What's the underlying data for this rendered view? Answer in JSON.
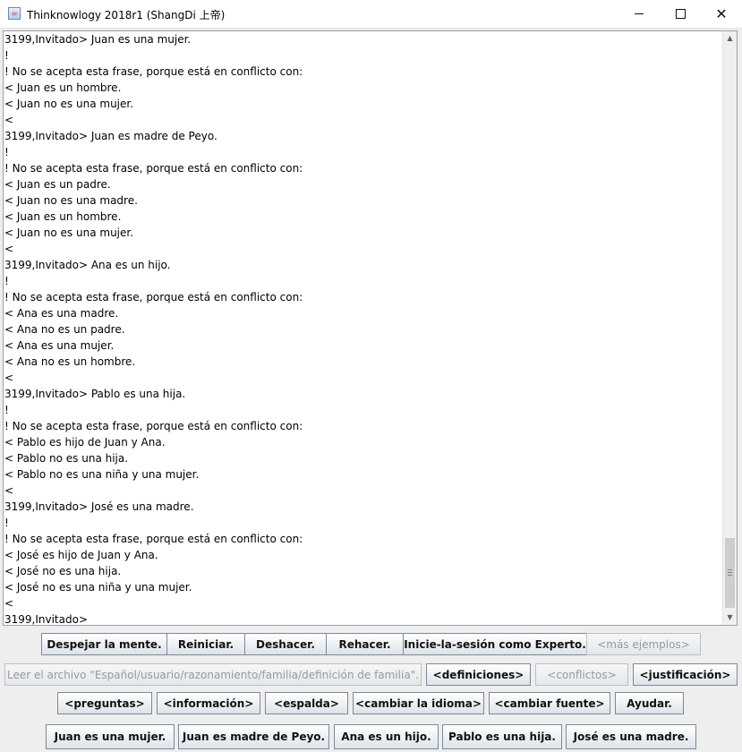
{
  "window": {
    "title": "Thinknowlogy 2018r1 (ShangDi 上帝)",
    "icon": "java-cup-icon",
    "minimize": "minimize-icon",
    "maximize": "maximize-icon",
    "close": "close-icon"
  },
  "output": {
    "lines": [
      "3199,Invitado> Juan es una mujer.",
      "!",
      "! No se acepta esta frase, porque está en conflicto con:",
      "< Juan es un hombre.",
      "< Juan no es una mujer.",
      "<",
      "3199,Invitado> Juan es madre de Peyo.",
      "!",
      "! No se acepta esta frase, porque está en conflicto con:",
      "< Juan es un padre.",
      "< Juan no es una madre.",
      "< Juan es un hombre.",
      "< Juan no es una mujer.",
      "<",
      "3199,Invitado> Ana es un hijo.",
      "!",
      "! No se acepta esta frase, porque está en conflicto con:",
      "< Ana es una madre.",
      "< Ana no es un padre.",
      "< Ana es una mujer.",
      "< Ana no es un hombre.",
      "<",
      "3199,Invitado> Pablo es una hija.",
      "!",
      "! No se acepta esta frase, porque está en conflicto con:",
      "< Pablo es hijo de Juan y Ana.",
      "< Pablo no es una hija.",
      "< Pablo no es una niña y una mujer.",
      "<",
      "3199,Invitado> José es una madre.",
      "!",
      "! No se acepta esta frase, porque está en conflicto con:",
      "< José es hijo de Juan y Ana.",
      "< José no es una hija.",
      "< José no es una niña y una mujer.",
      "<",
      "3199,Invitado>"
    ]
  },
  "buttons": {
    "row1": [
      {
        "name": "clear-mind-button",
        "label": "Despejar la mente.",
        "enabled": true
      },
      {
        "name": "restart-button",
        "label": "Reiniciar.",
        "enabled": true
      },
      {
        "name": "undo-button",
        "label": "Deshacer.",
        "enabled": true
      },
      {
        "name": "redo-button",
        "label": "Rehacer.",
        "enabled": true
      },
      {
        "name": "login-expert-button",
        "label": "Inicie-la-sesión como Experto.",
        "enabled": true
      },
      {
        "name": "more-examples-button",
        "label": "<más ejemplos>",
        "enabled": false
      }
    ],
    "row2": [
      {
        "name": "read-file-button",
        "label": "Leer el archivo \"Español/usuario/razonamiento/familia/definición de familia\".",
        "enabled": false
      },
      {
        "name": "definitions-button",
        "label": "<definiciones>",
        "enabled": true
      },
      {
        "name": "conflicts-button",
        "label": "<conflictos>",
        "enabled": false
      },
      {
        "name": "justification-button",
        "label": "<justificación>",
        "enabled": true
      }
    ],
    "row3": [
      {
        "name": "questions-button",
        "label": "<preguntas>",
        "enabled": true
      },
      {
        "name": "information-button",
        "label": "<información>",
        "enabled": true
      },
      {
        "name": "back-button",
        "label": "<espalda>",
        "enabled": true
      },
      {
        "name": "change-language-button",
        "label": "<cambiar la idioma>",
        "enabled": true
      },
      {
        "name": "change-font-button",
        "label": "<cambiar fuente>",
        "enabled": true
      },
      {
        "name": "help-button",
        "label": "Ayudar.",
        "enabled": true
      }
    ],
    "row4": [
      {
        "name": "sentence-juan-mujer-button",
        "label": "Juan es una mujer.",
        "enabled": true
      },
      {
        "name": "sentence-juan-madre-button",
        "label": "Juan es madre de Peyo.",
        "enabled": true
      },
      {
        "name": "sentence-ana-hijo-button",
        "label": "Ana es un hijo.",
        "enabled": true
      },
      {
        "name": "sentence-pablo-hija-button",
        "label": "Pablo es una hija.",
        "enabled": true
      },
      {
        "name": "sentence-jose-madre-button",
        "label": "José es una madre.",
        "enabled": true
      }
    ]
  },
  "colors": {
    "window_bg": "#eeeeee",
    "text_area_bg": "#ffffff",
    "button_border": "#7a8a99",
    "disabled_text": "#999999"
  }
}
